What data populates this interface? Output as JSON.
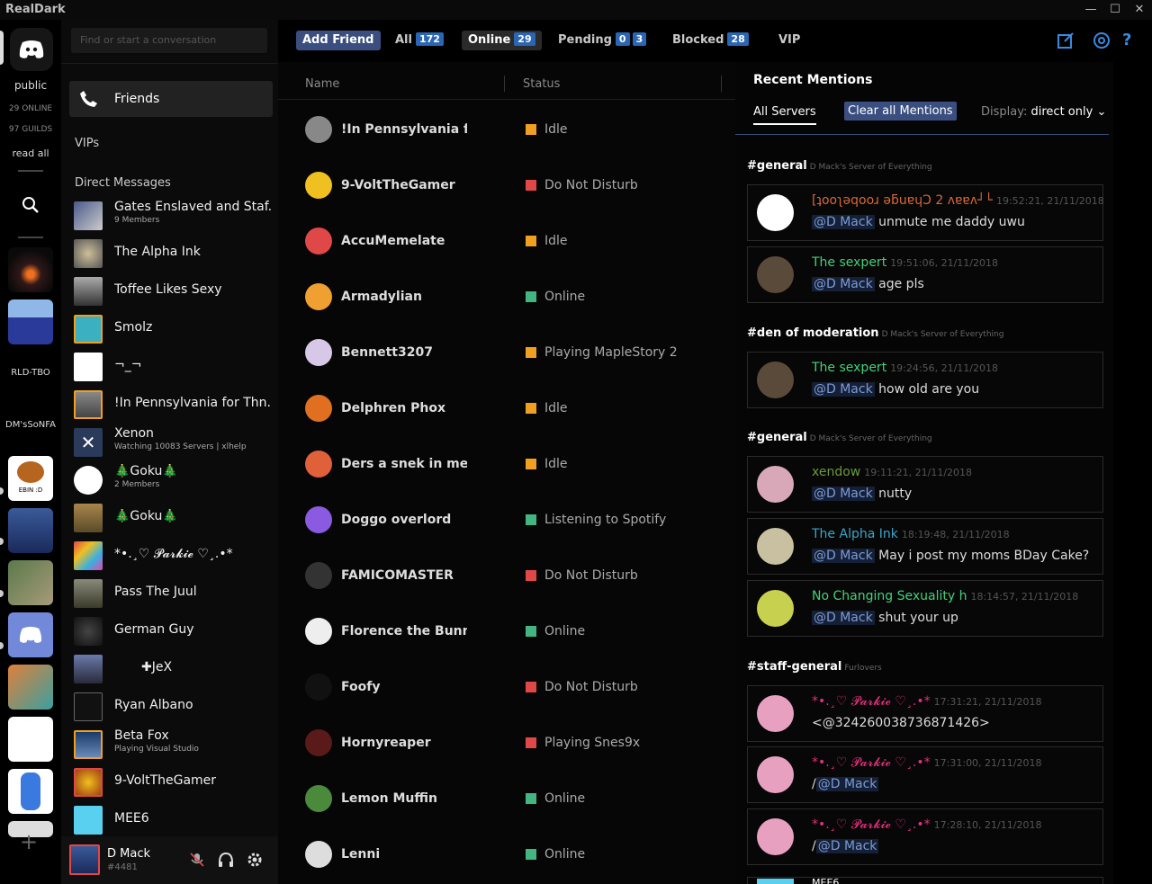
{
  "app": {
    "title": "RealDark"
  },
  "colors": {
    "accent": "#3a4f7f",
    "badge": "#2a66b3",
    "idle": "#f0a020",
    "dnd": "#e04848",
    "online": "#43b581"
  },
  "guilds": {
    "public_label": "public",
    "online_count": "29 ONLINE",
    "guild_count": "97 GUILDS",
    "read_all": "read all",
    "folder_a": "RLD-TBO",
    "folder_b": "DM'sSoNFA",
    "ebin_label": "EBIN :D"
  },
  "dmcol": {
    "search_placeholder": "Find or start a conversation",
    "friends_label": "Friends",
    "vips_label": "VIPs",
    "dm_header": "Direct Messages",
    "dms": [
      {
        "name": "Gates Enslaved and Staf...",
        "sub": "9 Members"
      },
      {
        "name": "The Alpha Ink",
        "sub": ""
      },
      {
        "name": "Toffee Likes Sexy",
        "sub": ""
      },
      {
        "name": "Smolz",
        "sub": ""
      },
      {
        "name": "¬_¬",
        "sub": ""
      },
      {
        "name": "!In Pennsylvania for Thn...",
        "sub": ""
      },
      {
        "name": "Xenon",
        "sub": "Watching 10083 Servers | xlhelp"
      },
      {
        "name": "🎄Goku🎄",
        "sub": "2 Members"
      },
      {
        "name": "🎄Goku🎄",
        "sub": ""
      },
      {
        "name": "*•.¸♡ 𝓟𝓪𝓻𝓴𝓲𝓮 ♡¸.•*",
        "sub": ""
      },
      {
        "name": "Pass The Juul",
        "sub": ""
      },
      {
        "name": "German Guy",
        "sub": ""
      },
      {
        "name": "✚JeX",
        "sub": ""
      },
      {
        "name": "Ryan Albano",
        "sub": ""
      },
      {
        "name": "Beta Fox",
        "sub": "Playing Visual Studio"
      },
      {
        "name": "9-VoltTheGamer",
        "sub": ""
      },
      {
        "name": "MEE6",
        "sub": ""
      }
    ],
    "user": {
      "name": "D Mack",
      "tag": "#4481"
    }
  },
  "toolbar": {
    "add_friend": "Add Friend",
    "all_label": "All",
    "all_count": "172",
    "online_label": "Online",
    "online_count": "29",
    "pending_label": "Pending",
    "pending_in": "0",
    "pending_out": "3",
    "blocked_label": "Blocked",
    "blocked_count": "28",
    "vip_label": "VIP"
  },
  "friends": {
    "col_name": "Name",
    "col_status": "Status",
    "rows": [
      {
        "name": "!In Pennsylvania f...",
        "status": "Idle",
        "kind": "idle"
      },
      {
        "name": "9-VoltTheGamer",
        "status": "Do Not Disturb",
        "kind": "dnd"
      },
      {
        "name": "AccuMemelate",
        "status": "Idle",
        "kind": "idle"
      },
      {
        "name": "Armadylian",
        "status": "Online",
        "kind": "online"
      },
      {
        "name": "Bennett3207",
        "status": "Playing MapleStory 2",
        "kind": "idle"
      },
      {
        "name": "Delphren Phox",
        "status": "Idle",
        "kind": "idle"
      },
      {
        "name": "Ders a snek in me...",
        "status": "Idle",
        "kind": "idle"
      },
      {
        "name": "Doggo overlord",
        "status": "Listening to Spotify",
        "kind": "online"
      },
      {
        "name": "FAMICOMASTER",
        "status": "Do Not Disturb",
        "kind": "dnd"
      },
      {
        "name": "Florence the Bunn...",
        "status": "Online",
        "kind": "online"
      },
      {
        "name": "Foofy",
        "status": "Do Not Disturb",
        "kind": "dnd"
      },
      {
        "name": "Hornyreaper",
        "status": "Playing Snes9x",
        "kind": "dnd"
      },
      {
        "name": "Lemon Muffin",
        "status": "Online",
        "kind": "online"
      },
      {
        "name": "Lenni",
        "status": "Online",
        "kind": "online"
      }
    ]
  },
  "mentions": {
    "title": "Recent Mentions",
    "tab_all": "All Servers",
    "clear_all": "Clear all Mentions",
    "display_label": "Display:",
    "display_value": "direct only",
    "groups": [
      {
        "channel": "#general",
        "server": "D Mack's Server of Everything",
        "items": [
          {
            "author": "[ʇooʅǝqooɹ ǝƃuɐɥƆ 2 ʌɐɐʌ┘└",
            "color": "#d9683a",
            "ts": "19:52:21, 21/11/2018",
            "mention": "@D Mack",
            "text": "unmute me daddy uwu"
          },
          {
            "author": "The sexpert",
            "color": "#43d17a",
            "ts": "19:51:06, 21/11/2018",
            "mention": "@D Mack",
            "text": "age pls"
          }
        ]
      },
      {
        "channel": "#den of moderation",
        "server": "D Mack's Server of Everything",
        "items": [
          {
            "author": "The sexpert",
            "color": "#43d17a",
            "ts": "19:24:56, 21/11/2018",
            "mention": "@D Mack",
            "text": "how old are you"
          }
        ]
      },
      {
        "channel": "#general",
        "server": "D Mack's Server of Everything",
        "items": [
          {
            "author": "xendow",
            "color": "#6a9a3a",
            "ts": "19:11:21, 21/11/2018",
            "mention": "@D Mack",
            "text": "nutty"
          },
          {
            "author": "The Alpha Ink",
            "color": "#3aa6c9",
            "ts": "18:19:48, 21/11/2018",
            "mention": "@D Mack",
            "text": "May i post my moms BDay Cake?"
          },
          {
            "author": "No Changing Sexuality h",
            "color": "#43d17a",
            "ts": "18:14:57, 21/11/2018",
            "mention": "@D Mack",
            "text": "shut your up"
          }
        ]
      },
      {
        "channel": "#staff-general",
        "server": "Furlovers",
        "items": [
          {
            "author": "*•.¸♡ 𝓟𝓪𝓻𝓴𝓲𝓮 ♡¸.•*",
            "color": "#e0307a",
            "ts": "17:31:21, 21/11/2018",
            "mention": "",
            "text": "<@324260038736871426>"
          },
          {
            "author": "*•.¸♡ 𝓟𝓪𝓻𝓴𝓲𝓮 ♡¸.•*",
            "color": "#e0307a",
            "ts": "17:31:00, 21/11/2018",
            "mention": "@D Mack",
            "text": "/"
          },
          {
            "author": "*•.¸♡ 𝓟𝓪𝓻𝓴𝓲𝓮 ♡¸.•*",
            "color": "#e0307a",
            "ts": "17:28:10, 21/11/2018",
            "mention": "@D Mack",
            "text": "/"
          }
        ]
      }
    ],
    "last_partial": "MEE6"
  }
}
